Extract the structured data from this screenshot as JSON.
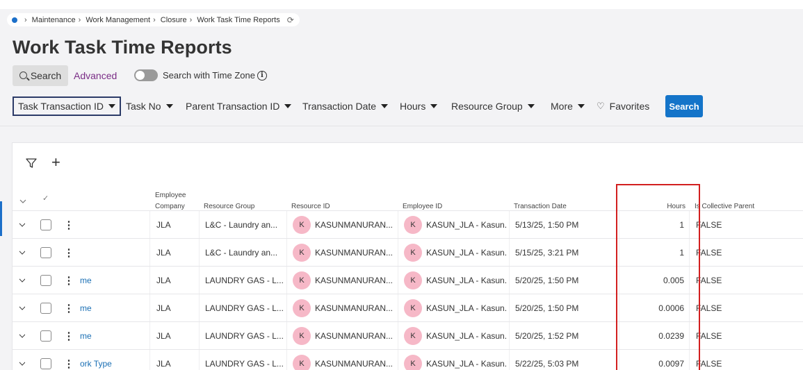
{
  "breadcrumb": {
    "items": [
      "Maintenance",
      "Work Management",
      "Closure",
      "Work Task Time Reports"
    ]
  },
  "page": {
    "title": "Work Task Time Reports"
  },
  "search_bar": {
    "search_tab": "Search",
    "advanced_tab": "Advanced",
    "timezone_label": "Search with Time Zone",
    "timezone_enabled": false
  },
  "filters": {
    "chips": [
      "Task Transaction ID",
      "Task No",
      "Parent Transaction ID",
      "Transaction Date",
      "Hours",
      "Resource Group",
      "More"
    ],
    "favorites": "Favorites",
    "search_button": "Search"
  },
  "table": {
    "headers": {
      "employee_company": [
        "Employee",
        "Company"
      ],
      "resource_group": "Resource Group",
      "resource_id": "Resource ID",
      "employee_id": "Employee ID",
      "transaction_date": "Transaction Date",
      "hours": "Hours",
      "is_collective_parent": "Is Collective Parent"
    },
    "rows": [
      {
        "link": "",
        "company": "JLA",
        "resource_group": "L&C - Laundry an...",
        "avatar": "K",
        "resource_id": "KASUNMANURAN...",
        "employee_id": "KASUN_JLA - Kasun...",
        "date": "5/13/25, 1:50 PM",
        "hours": "1",
        "collective": "FALSE"
      },
      {
        "link": "",
        "company": "JLA",
        "resource_group": "L&C - Laundry an...",
        "avatar": "K",
        "resource_id": "KASUNMANURAN...",
        "employee_id": "KASUN_JLA - Kasun...",
        "date": "5/15/25, 3:21 PM",
        "hours": "1",
        "collective": "FALSE"
      },
      {
        "link": "me",
        "company": "JLA",
        "resource_group": "LAUNDRY GAS - L...",
        "avatar": "K",
        "resource_id": "KASUNMANURAN...",
        "employee_id": "KASUN_JLA - Kasun...",
        "date": "5/20/25, 1:50 PM",
        "hours": "0.005",
        "collective": "FALSE"
      },
      {
        "link": "me",
        "company": "JLA",
        "resource_group": "LAUNDRY GAS - L...",
        "avatar": "K",
        "resource_id": "KASUNMANURAN...",
        "employee_id": "KASUN_JLA - Kasun...",
        "date": "5/20/25, 1:50 PM",
        "hours": "0.0006",
        "collective": "FALSE"
      },
      {
        "link": "me",
        "company": "JLA",
        "resource_group": "LAUNDRY GAS - L...",
        "avatar": "K",
        "resource_id": "KASUNMANURAN...",
        "employee_id": "KASUN_JLA - Kasun...",
        "date": "5/20/25, 1:52 PM",
        "hours": "0.0239",
        "collective": "FALSE"
      },
      {
        "link": "ork Type",
        "company": "JLA",
        "resource_group": "LAUNDRY GAS - L...",
        "avatar": "K",
        "resource_id": "KASUNMANURAN...",
        "employee_id": "KASUN_JLA - Kasun...",
        "date": "5/22/25, 5:03 PM",
        "hours": "0.0097",
        "collective": "FALSE"
      }
    ]
  },
  "colors": {
    "accent": "#1474c9",
    "advanced": "#7a2d86",
    "highlight_box": "#d21f1f",
    "avatar": "#f6b8c7"
  }
}
